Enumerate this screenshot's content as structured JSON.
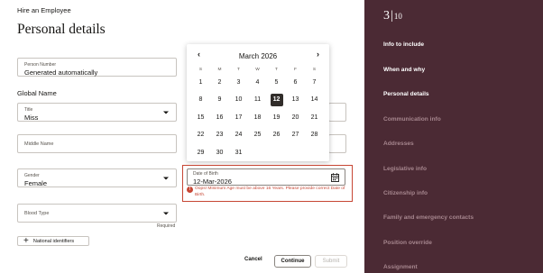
{
  "header": {
    "app_title": "Hire an Employee",
    "page_title": "Personal details"
  },
  "form": {
    "person_number": {
      "label": "Person Number",
      "value": "Generated automatically"
    },
    "global_name_label": "Global Name",
    "title": {
      "label": "Title",
      "value": "Miss"
    },
    "middle_name": {
      "label": "Middle Name",
      "value": ""
    },
    "gender": {
      "label": "Gender",
      "value": "Female"
    },
    "blood_type": {
      "label": "Blood Type",
      "value": ""
    },
    "required_note": "Required",
    "national_identifiers_label": "National identifiers",
    "date_of_birth": {
      "label": "Date of Birth",
      "value": "12-Mar-2026",
      "error": "Oops! Minimum Age must be above 16 Years. Please provide correct Date of Birth."
    }
  },
  "calendar": {
    "month_label": "March 2026",
    "weekdays": [
      "S",
      "M",
      "T",
      "W",
      "T",
      "F",
      "S"
    ],
    "weeks": [
      [
        "1",
        "2",
        "3",
        "4",
        "5",
        "6",
        "7"
      ],
      [
        "8",
        "9",
        "10",
        "11",
        "12",
        "13",
        "14"
      ],
      [
        "15",
        "16",
        "17",
        "18",
        "19",
        "20",
        "21"
      ],
      [
        "22",
        "23",
        "24",
        "25",
        "26",
        "27",
        "28"
      ],
      [
        "29",
        "30",
        "31",
        "",
        "",
        "",
        ""
      ]
    ],
    "selected_day": "12"
  },
  "actions": {
    "cancel": "Cancel",
    "continue": "Continue",
    "submit": "Submit"
  },
  "guide": {
    "current_step": "3",
    "total_steps": "10",
    "items": [
      {
        "label": "Info to include",
        "state": "done"
      },
      {
        "label": "When and why",
        "state": "done"
      },
      {
        "label": "Personal details",
        "state": "current"
      },
      {
        "label": "Communication info",
        "state": "todo"
      },
      {
        "label": "Addresses",
        "state": "todo"
      },
      {
        "label": "Legislative info",
        "state": "todo"
      },
      {
        "label": "Citizenship info",
        "state": "todo"
      },
      {
        "label": "Family and emergency contacts",
        "state": "todo"
      },
      {
        "label": "Position override",
        "state": "todo"
      },
      {
        "label": "Assignment",
        "state": "todo"
      }
    ]
  },
  "colors": {
    "panel_bg": "#4b2a34",
    "error": "#c74634",
    "selected_day_bg": "#312d2a"
  }
}
